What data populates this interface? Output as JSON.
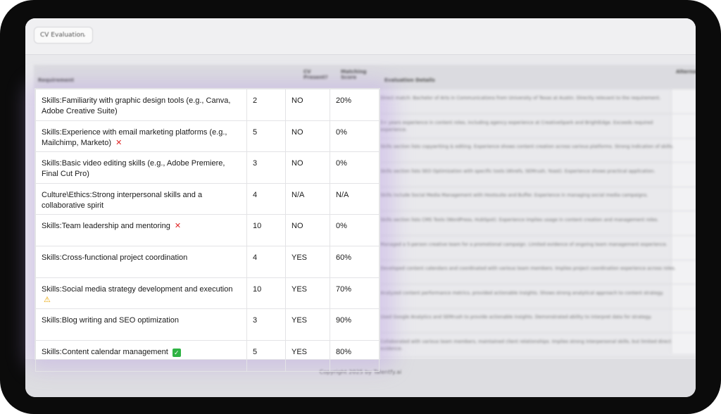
{
  "toolbar": {
    "select_value": "CV Evaluation"
  },
  "background_table": {
    "headers": [
      "Requirement",
      "CV Present?",
      "Matching Score",
      "Evaluation Details",
      "Alternative Match"
    ],
    "details": [
      "Direct match: Bachelor of Arts in Communications from University of Texas at Austin. Directly relevant to the requirement.",
      "5+ years experience in content roles, including agency experience at CreativeSpark and BrightEdge. Exceeds required experience.",
      "Skills section lists copywriting & editing. Experience shows content creation across various platforms. Strong indication of skills.",
      "Skills section lists SEO Optimization with specific tools (Ahrefs, SEMrush, Yoast). Experience shows practical application.",
      "Skills include Social Media Management with Hootsuite and Buffer. Experience in managing social media campaigns.",
      "Skills section lists CMS Tools (WordPress, HubSpot). Experience implies usage in content creation and management roles.",
      "Managed a 5-person creative team for a promotional campaign. Limited evidence of ongoing team management experience.",
      "Developed content calendars and coordinated with various team members. Implies project coordination experience across roles.",
      "Analyzed content performance metrics, provided actionable insights. Shows strong analytical approach to content strategy.",
      "Used Google Analytics and SEMrush to provide actionable insights. Demonstrated ability to interpret data for strategy.",
      "Collaborated with various team members, maintained client relationships. Implies strong interpersonal skills, but limited direct evidence."
    ]
  },
  "rows": [
    {
      "requirement": "Skills:Familiarity with graphic design tools (e.g., Canva, Adobe Creative Suite)",
      "icon": "",
      "weight": "2",
      "present": "NO",
      "score": "20%"
    },
    {
      "requirement": "Skills:Experience with email marketing platforms (e.g., Mailchimp, Marketo)",
      "icon": "cross-icon",
      "weight": "5",
      "present": "NO",
      "score": "0%"
    },
    {
      "requirement": "Skills:Basic video editing skills (e.g., Adobe Premiere, Final Cut Pro)",
      "icon": "",
      "weight": "3",
      "present": "NO",
      "score": "0%"
    },
    {
      "requirement": "Culture\\Ethics:Strong interpersonal skills and a collaborative spirit",
      "icon": "",
      "weight": "4",
      "present": "N/A",
      "score": "N/A"
    },
    {
      "requirement": "Skills:Team leadership and mentoring",
      "icon": "cross-icon",
      "weight": "10",
      "present": "NO",
      "score": "0%"
    },
    {
      "requirement": "Skills:Cross-functional project coordination",
      "icon": "",
      "weight": "4",
      "present": "YES",
      "score": "60%"
    },
    {
      "requirement": "Skills:Social media strategy development and execution",
      "icon": "warning-icon",
      "weight": "10",
      "present": "YES",
      "score": "70%"
    },
    {
      "requirement": "Skills:Blog writing and SEO optimization",
      "icon": "",
      "weight": "3",
      "present": "YES",
      "score": "90%"
    },
    {
      "requirement": "Skills:Content calendar management",
      "icon": "check-icon",
      "weight": "5",
      "present": "YES",
      "score": "80%"
    }
  ],
  "footer": {
    "text": "Copyright 2025 by Talentfy.ai"
  },
  "colors": {
    "cross": "#e02424",
    "warning": "#e8a400",
    "check": "#2fb344",
    "glow": "#b496e6"
  }
}
